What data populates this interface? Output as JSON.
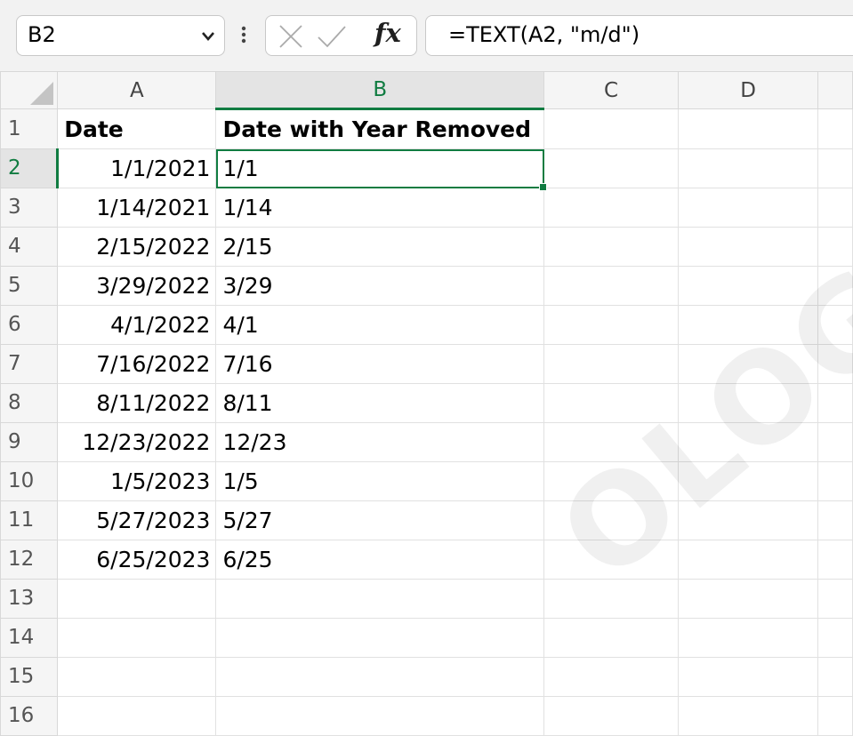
{
  "formula_bar": {
    "name_box": "B2",
    "formula": "=TEXT(A2, \"m/d\")",
    "fx_label": "fx"
  },
  "columns": [
    "A",
    "B",
    "C",
    "D"
  ],
  "selected_column": "B",
  "selected_row": "2",
  "rows": [
    {
      "num": "1",
      "a": "Date",
      "b": "Date with Year Removed"
    },
    {
      "num": "2",
      "a": "1/1/2021",
      "b": "1/1"
    },
    {
      "num": "3",
      "a": "1/14/2021",
      "b": "1/14"
    },
    {
      "num": "4",
      "a": "2/15/2022",
      "b": "2/15"
    },
    {
      "num": "5",
      "a": "3/29/2022",
      "b": "3/29"
    },
    {
      "num": "6",
      "a": "4/1/2022",
      "b": "4/1"
    },
    {
      "num": "7",
      "a": "7/16/2022",
      "b": "7/16"
    },
    {
      "num": "8",
      "a": "8/11/2022",
      "b": "8/11"
    },
    {
      "num": "9",
      "a": "12/23/2022",
      "b": "12/23"
    },
    {
      "num": "10",
      "a": "1/5/2023",
      "b": "1/5"
    },
    {
      "num": "11",
      "a": "5/27/2023",
      "b": "5/27"
    },
    {
      "num": "12",
      "a": "6/25/2023",
      "b": "6/25"
    },
    {
      "num": "13",
      "a": "",
      "b": ""
    },
    {
      "num": "14",
      "a": "",
      "b": ""
    },
    {
      "num": "15",
      "a": "",
      "b": ""
    },
    {
      "num": "16",
      "a": "",
      "b": ""
    }
  ],
  "watermark": "OLOGY",
  "colors": {
    "accent": "#107c41"
  }
}
